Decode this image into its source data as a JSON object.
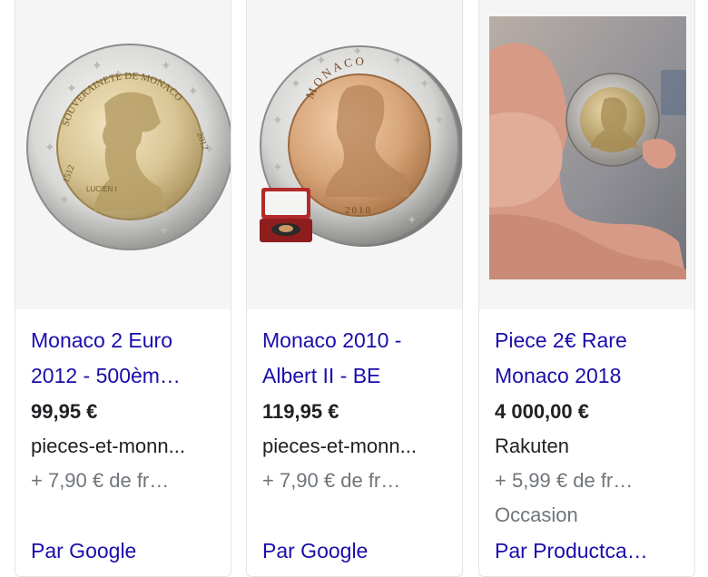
{
  "products": [
    {
      "title_line1": "Monaco 2 Euro",
      "title_line2": "2012 - 500èm…",
      "price": "99,95 €",
      "merchant": "pieces-et-monn...",
      "shipping": "+ 7,90 € de fr…",
      "condition": "",
      "via": "Par Google",
      "coin_text_top": "SOUVERAINETÉ DE MONACO",
      "coin_year_left": "1512",
      "coin_year_right": "2012",
      "coin_signature": "LUCIEN I"
    },
    {
      "title_line1": "Monaco 2010 -",
      "title_line2": "Albert II - BE",
      "price": "119,95 €",
      "merchant": "pieces-et-monn...",
      "shipping": "+ 7,90 € de fr…",
      "condition": "",
      "via": "Par Google",
      "coin_text_top": "MONACO",
      "coin_year": "2010"
    },
    {
      "title_line1": "Piece 2€ Rare",
      "title_line2": "Monaco 2018",
      "price": "4 000,00 €",
      "merchant": "Rakuten",
      "shipping": "+ 5,99 € de fr…",
      "condition": "Occasion",
      "via": "Par Productca…"
    }
  ],
  "colors": {
    "link": "#1a0dab",
    "text": "#202124",
    "muted": "#70757a",
    "card_border": "#e4e4e4",
    "image_bg": "#f5f5f5"
  }
}
